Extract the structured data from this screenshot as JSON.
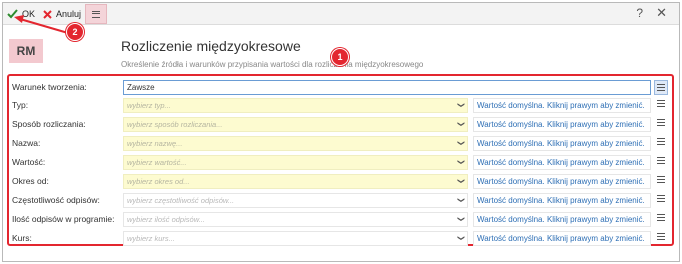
{
  "toolbar": {
    "ok_label": "OK",
    "cancel_label": "Anuluj",
    "help_label": "?",
    "close_label": "✕"
  },
  "header": {
    "badge": "RM",
    "title": "Rozliczenie międzyokresowe",
    "subtitle": "Określenie źródła i warunków przypisania wartości dla rozliczenia międzyokresowego"
  },
  "callouts": [
    "1",
    "2"
  ],
  "form": {
    "first_row": {
      "label": "Warunek tworzenia:",
      "value": "Zawsze"
    },
    "rows": [
      {
        "label": "Typ:",
        "placeholder": "wybierz typ...",
        "highlight": true,
        "default_text": "Wartość domyślna. Kliknij prawym aby zmienić."
      },
      {
        "label": "Sposób rozliczania:",
        "placeholder": "wybierz sposób rozliczania...",
        "highlight": true,
        "default_text": "Wartość domyślna. Kliknij prawym aby zmienić."
      },
      {
        "label": "Nazwa:",
        "placeholder": "wybierz nazwę...",
        "highlight": true,
        "default_text": "Wartość domyślna. Kliknij prawym aby zmienić."
      },
      {
        "label": "Wartość:",
        "placeholder": "wybierz wartość...",
        "highlight": true,
        "default_text": "Wartość domyślna. Kliknij prawym aby zmienić."
      },
      {
        "label": "Okres od:",
        "placeholder": "wybierz okres od...",
        "highlight": true,
        "default_text": "Wartość domyślna. Kliknij prawym aby zmienić."
      },
      {
        "label": "Częstotliwość odpisów:",
        "placeholder": "wybierz częstotliwość odpisów...",
        "highlight": false,
        "default_text": "Wartość domyślna. Kliknij prawym aby zmienić."
      },
      {
        "label": "Ilość odpisów w programie:",
        "placeholder": "wybierz ilość odpisów...",
        "highlight": false,
        "default_text": "Wartość domyślna. Kliknij prawym aby zmienić."
      },
      {
        "label": "Kurs:",
        "placeholder": "wybierz kurs...",
        "highlight": false,
        "default_text": "Wartość domyślna. Kliknij prawym aby zmienić."
      }
    ]
  },
  "colors": {
    "accent_red": "#e3262f",
    "link_blue": "#2e6fb5",
    "required_yellow": "#fdfbd0",
    "ok_green": "#2e8b2e"
  },
  "icons": [
    "checkmark-icon",
    "cross-icon",
    "hamburger-menu-icon",
    "help-icon",
    "close-icon",
    "chevron-down-icon"
  ]
}
